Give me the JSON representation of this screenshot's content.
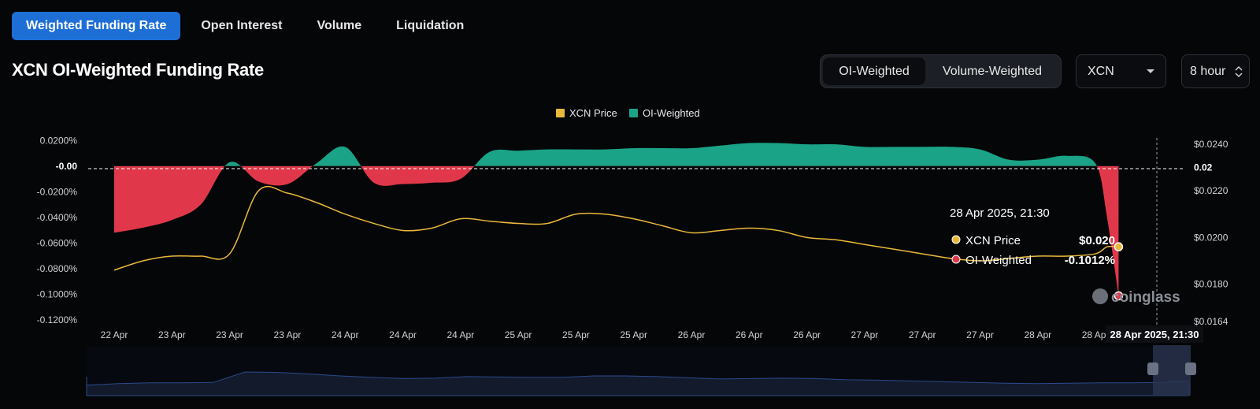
{
  "tabs": [
    "Weighted Funding Rate",
    "Open Interest",
    "Volume",
    "Liquidation"
  ],
  "title": "XCN OI-Weighted Funding Rate",
  "toggle": {
    "selected": "OI-Weighted",
    "other": "Volume-Weighted"
  },
  "coin_select": "XCN",
  "interval_select": "8 hour",
  "watermark": "coinglass",
  "colors": {
    "price": "#e9b83b",
    "positive": "#1aa386",
    "negative": "#e0384a",
    "accent": "#1d6fd6"
  },
  "tooltip": {
    "date": "28 Apr 2025, 21:30",
    "rows": [
      {
        "label": "XCN Price",
        "value": "$0.020"
      },
      {
        "label": "OI-Weighted",
        "value": "-0.1012%"
      }
    ]
  },
  "chart_data": {
    "type": "area",
    "legend": [
      "XCN Price",
      "OI-Weighted"
    ],
    "legend_position": "top-center",
    "x_ticks": [
      "22 Apr",
      "23 Apr",
      "23 Apr",
      "23 Apr",
      "24 Apr",
      "24 Apr",
      "24 Apr",
      "25 Apr",
      "25 Apr",
      "25 Apr",
      "26 Apr",
      "26 Apr",
      "26 Apr",
      "27 Apr",
      "27 Apr",
      "27 Apr",
      "28 Apr",
      "28 Apr"
    ],
    "y_left_ticks": [
      "0.0200%",
      "-0.00",
      "-0.0200%",
      "-0.0400%",
      "-0.0600%",
      "-0.0800%",
      "-0.1000%",
      "-0.1200%"
    ],
    "y_right_ticks": [
      "$0.0240",
      "0.02",
      "$0.0220",
      "$0.0200",
      "$0.0180",
      "$0.0164"
    ],
    "y_left_range": [
      -0.12,
      0.022
    ],
    "y_right_range": [
      0.0164,
      0.0245
    ],
    "cursor_label": "28 Apr 2025, 21:30",
    "series": [
      {
        "name": "OI-Weighted",
        "x": [
          0,
          0.5,
          1,
          1.5,
          2,
          2.5,
          3,
          3.5,
          4,
          4.5,
          5,
          5.5,
          6,
          6.5,
          7,
          7.5,
          8,
          8.5,
          9,
          9.5,
          10,
          10.5,
          11,
          11.5,
          12,
          12.5,
          13,
          13.5,
          14,
          14.5,
          15,
          15.5,
          16,
          16.5,
          17,
          17.2,
          17.4
        ],
        "values": [
          -0.052,
          -0.048,
          -0.042,
          -0.03,
          0.003,
          -0.012,
          -0.014,
          0.002,
          0.015,
          -0.013,
          -0.014,
          -0.013,
          -0.01,
          0.011,
          0.012,
          0.013,
          0.013,
          0.013,
          0.014,
          0.014,
          0.014,
          0.016,
          0.018,
          0.018,
          0.017,
          0.017,
          0.015,
          0.015,
          0.015,
          0.015,
          0.013,
          0.005,
          0.005,
          0.008,
          0.002,
          -0.04,
          -0.1012
        ]
      },
      {
        "name": "XCN Price",
        "x": [
          0,
          0.5,
          1,
          1.5,
          2,
          2.5,
          3,
          3.5,
          4,
          4.5,
          5,
          5.5,
          6,
          6.5,
          7,
          7.5,
          8,
          8.5,
          9,
          9.5,
          10,
          10.5,
          11,
          11.5,
          12,
          12.5,
          13,
          13.5,
          14,
          14.5,
          15,
          15.5,
          16,
          16.5,
          17,
          17.2,
          17.4
        ],
        "values": [
          0.0186,
          0.019,
          0.0192,
          0.0192,
          0.0193,
          0.022,
          0.0219,
          0.0215,
          0.021,
          0.0206,
          0.0203,
          0.0204,
          0.0208,
          0.0207,
          0.0206,
          0.0206,
          0.021,
          0.021,
          0.0208,
          0.0205,
          0.0202,
          0.0203,
          0.0204,
          0.0203,
          0.02,
          0.0199,
          0.0197,
          0.0195,
          0.0193,
          0.0191,
          0.019,
          0.0191,
          0.0192,
          0.0192,
          0.0193,
          0.0196,
          0.0196
        ]
      }
    ]
  }
}
